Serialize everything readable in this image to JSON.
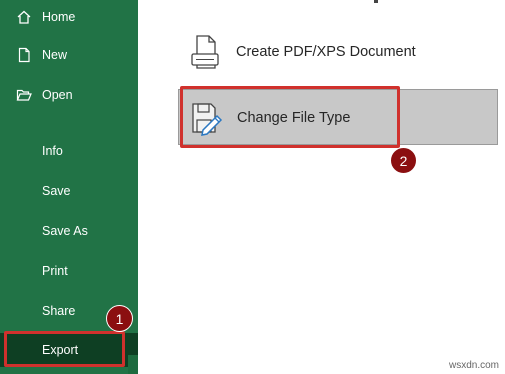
{
  "sidebar": {
    "items": [
      {
        "label": "Home",
        "icon": "home-icon"
      },
      {
        "label": "New",
        "icon": "new-document-icon"
      },
      {
        "label": "Open",
        "icon": "open-folder-icon"
      },
      {
        "label": "Info"
      },
      {
        "label": "Save"
      },
      {
        "label": "Save As"
      },
      {
        "label": "Print"
      },
      {
        "label": "Share"
      },
      {
        "label": "Export",
        "selected": true
      }
    ]
  },
  "main": {
    "options": [
      {
        "label": "Create PDF/XPS Document",
        "icon": "pdf-document-icon"
      },
      {
        "label": "Change File Type",
        "icon": "change-file-type-icon",
        "selected": true
      }
    ]
  },
  "callouts": {
    "step1": "1",
    "step2": "2"
  },
  "watermark": "wsxdn.com",
  "colors": {
    "sidebar": "#217346",
    "sidebar_selected": "#0e3f23",
    "callout": "#d0312d",
    "badge": "#8b0f10"
  }
}
